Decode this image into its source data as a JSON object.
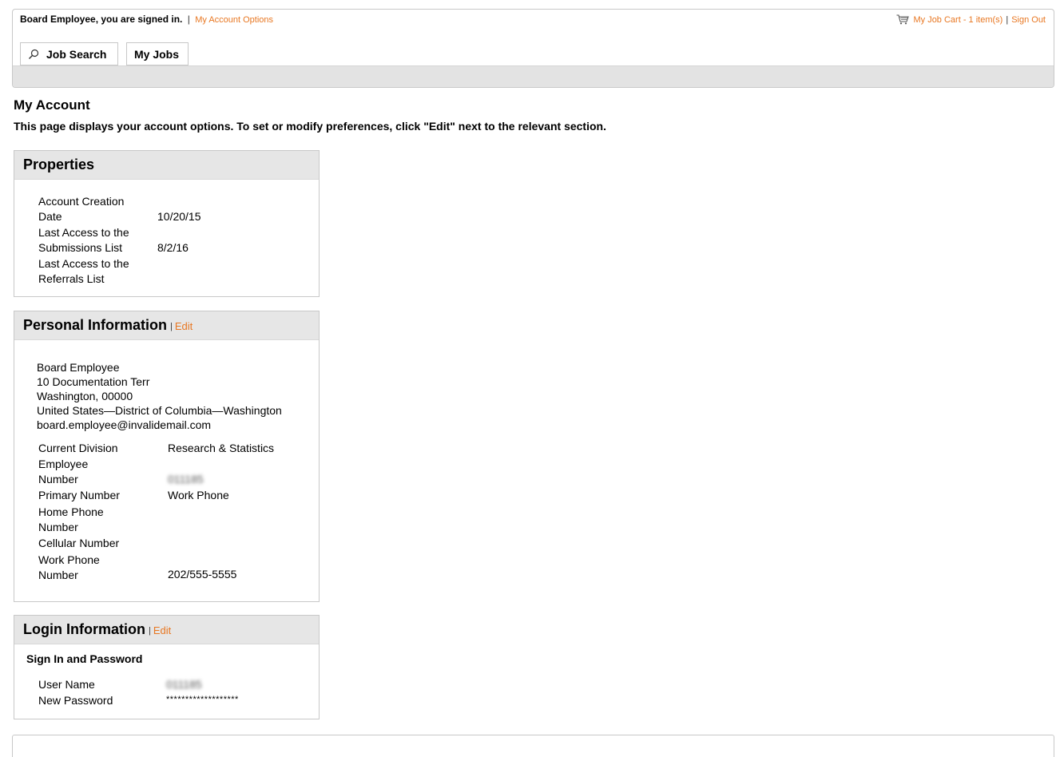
{
  "header": {
    "signed_in_text": "Board Employee, you are signed in.",
    "account_options_link": "My Account Options",
    "cart_link": "My Job Cart - 1 item(s)",
    "sign_out_link": "Sign Out",
    "separator": "|"
  },
  "nav": {
    "job_search": "Job Search",
    "my_jobs": "My Jobs"
  },
  "page": {
    "title": "My Account",
    "description": "This page displays your account options. To set or modify preferences, click \"Edit\" next to the relevant section."
  },
  "properties": {
    "title": "Properties",
    "rows": [
      {
        "label_1": "Account Creation",
        "label_2": "Date",
        "value": "10/20/15"
      },
      {
        "label_1": "Last Access to the",
        "label_2": "Submissions List",
        "value": "8/2/16"
      },
      {
        "label_1": "Last Access to the",
        "label_2": "Referrals List",
        "value": ""
      }
    ]
  },
  "personal": {
    "title": "Personal Information",
    "edit_label": "Edit",
    "address": [
      "Board Employee",
      "10 Documentation Terr",
      "Washington, 00000",
      "United States—District of Columbia—Washington",
      "board.employee@invalidemail.com"
    ],
    "current_division_label": "Current Division",
    "current_division_value": "Research & Statistics",
    "employee_number_label_1": "Employee",
    "employee_number_label_2": "Number",
    "employee_number_value": "011185",
    "primary_number_label": "Primary Number",
    "primary_number_value": "Work Phone",
    "home_phone_label_1": "Home Phone",
    "home_phone_label_2": "Number",
    "cellular_label": "Cellular Number",
    "work_phone_label_1": "Work Phone",
    "work_phone_label_2": "Number",
    "work_phone_value": "202/555-5555"
  },
  "login": {
    "title": "Login Information",
    "edit_label": "Edit",
    "subheading": "Sign In and Password",
    "username_label": "User Name",
    "username_value": "011185",
    "password_label": "New Password",
    "password_value": "*******************"
  },
  "colors": {
    "link": "#e87722",
    "panel_header": "#e6e6e6",
    "border": "#c8c8c8"
  }
}
